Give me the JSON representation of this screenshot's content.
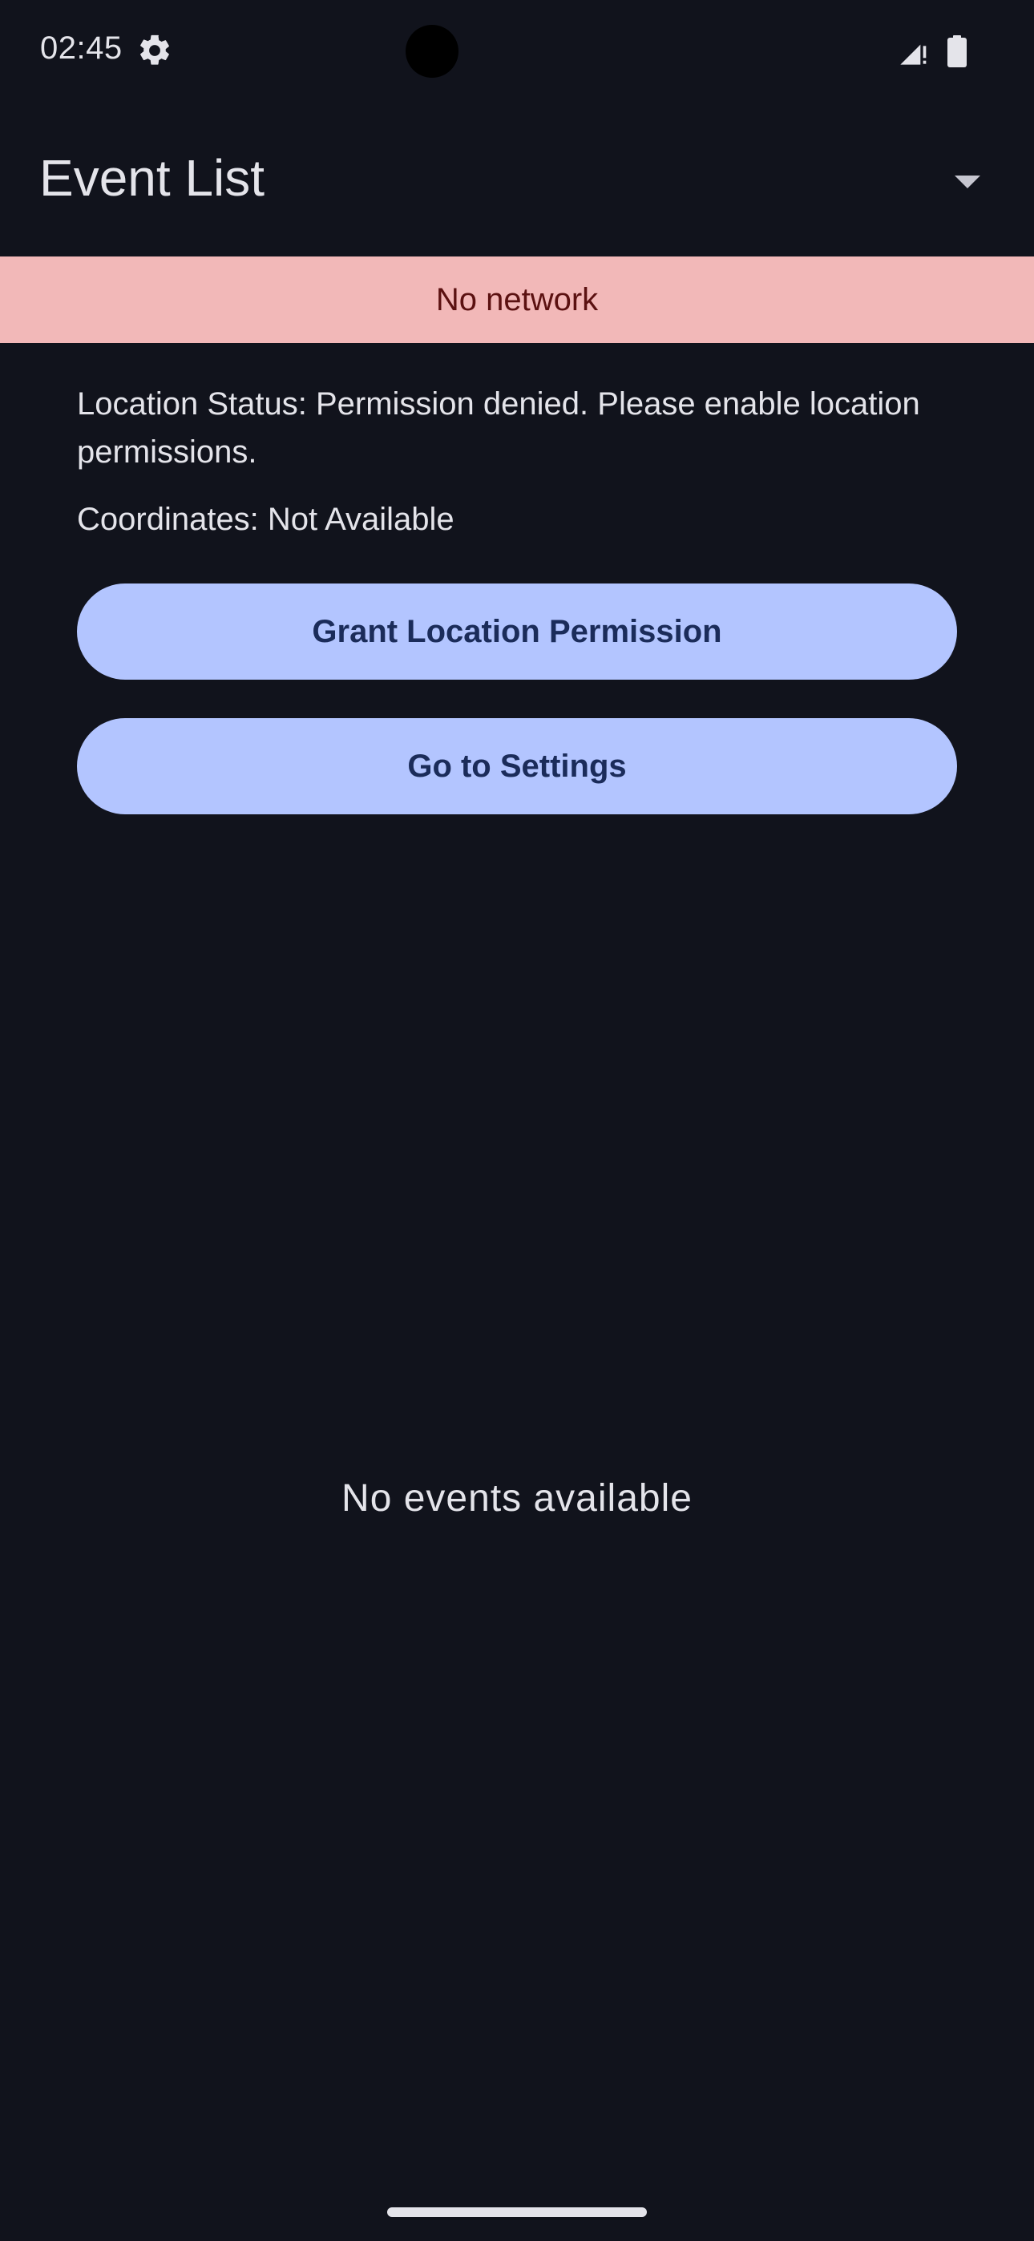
{
  "status_bar": {
    "time": "02:45",
    "icons": [
      "gear-icon",
      "signal-icon",
      "battery-icon"
    ]
  },
  "app_bar": {
    "title": "Event List",
    "dropdown_icon": "arrow-drop-down-icon"
  },
  "network_banner": {
    "text": "No network",
    "background": "#f2b8b8",
    "text_color": "#5b1111"
  },
  "location": {
    "status_text": "Location Status: Permission denied. Please enable location permissions.",
    "coordinates_text": "Coordinates: Not Available"
  },
  "buttons": {
    "grant_label": "Grant Location Permission",
    "settings_label": "Go to Settings",
    "color": "#b3c5ff"
  },
  "events": {
    "empty_text": "No events available"
  },
  "theme": {
    "background": "#11131c",
    "on_background": "#e4e4ea"
  }
}
